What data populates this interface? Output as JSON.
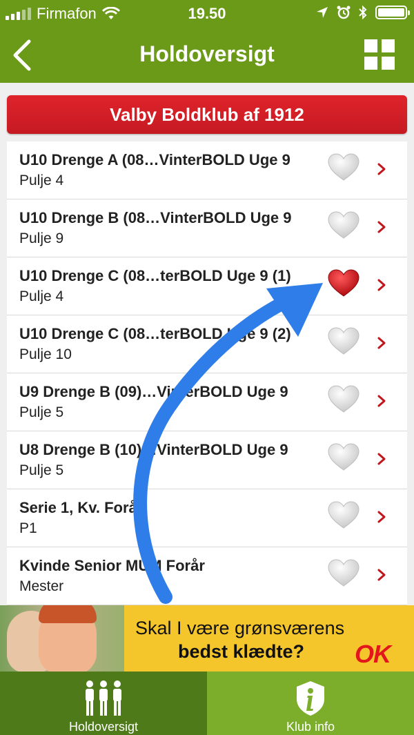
{
  "status": {
    "carrier": "Firmafon",
    "time": "19.50"
  },
  "nav": {
    "title": "Holdoversigt",
    "back_icon": "chevron-left-icon",
    "grid_icon": "grid-icon"
  },
  "club": {
    "name": "Valby Boldklub af 1912"
  },
  "teams": [
    {
      "name": "U10 Drenge A (08…VinterBOLD Uge 9",
      "group": "Pulje 4",
      "favorite": false
    },
    {
      "name": "U10 Drenge B (08…VinterBOLD Uge 9",
      "group": "Pulje 9",
      "favorite": false
    },
    {
      "name": "U10 Drenge C (08…terBOLD Uge 9 (1)",
      "group": "Pulje 4",
      "favorite": true
    },
    {
      "name": "U10 Drenge C (08…terBOLD Uge 9 (2)",
      "group": "Pulje 10",
      "favorite": false
    },
    {
      "name": "U9 Drenge B (09)…VinterBOLD Uge 9",
      "group": "Pulje 5",
      "favorite": false
    },
    {
      "name": "U8 Drenge B (10)…VinterBOLD Uge 9",
      "group": "Pulje 5",
      "favorite": false
    },
    {
      "name": "Serie 1, Kv. Forår",
      "group": "P1",
      "favorite": false
    },
    {
      "name": "Kvinde Senior MUM Forår",
      "group": "Mester",
      "favorite": false
    }
  ],
  "ad": {
    "line1": "Skal I være grønsværens",
    "line2": "bedst klædte?",
    "brand": "OK"
  },
  "tabs": [
    {
      "label": "Holdoversigt",
      "icon": "people-icon",
      "active": true
    },
    {
      "label": "Klub info",
      "icon": "info-shield-icon",
      "active": false
    }
  ],
  "colors": {
    "bar_green": "#6a9a18",
    "club_red": "#d11f26",
    "chevron_red": "#c0161d",
    "tab_dark": "#4f7a1a",
    "tab_light": "#7cae2c",
    "ad_yellow": "#f5c62c",
    "arrow_blue": "#2f7de8"
  }
}
